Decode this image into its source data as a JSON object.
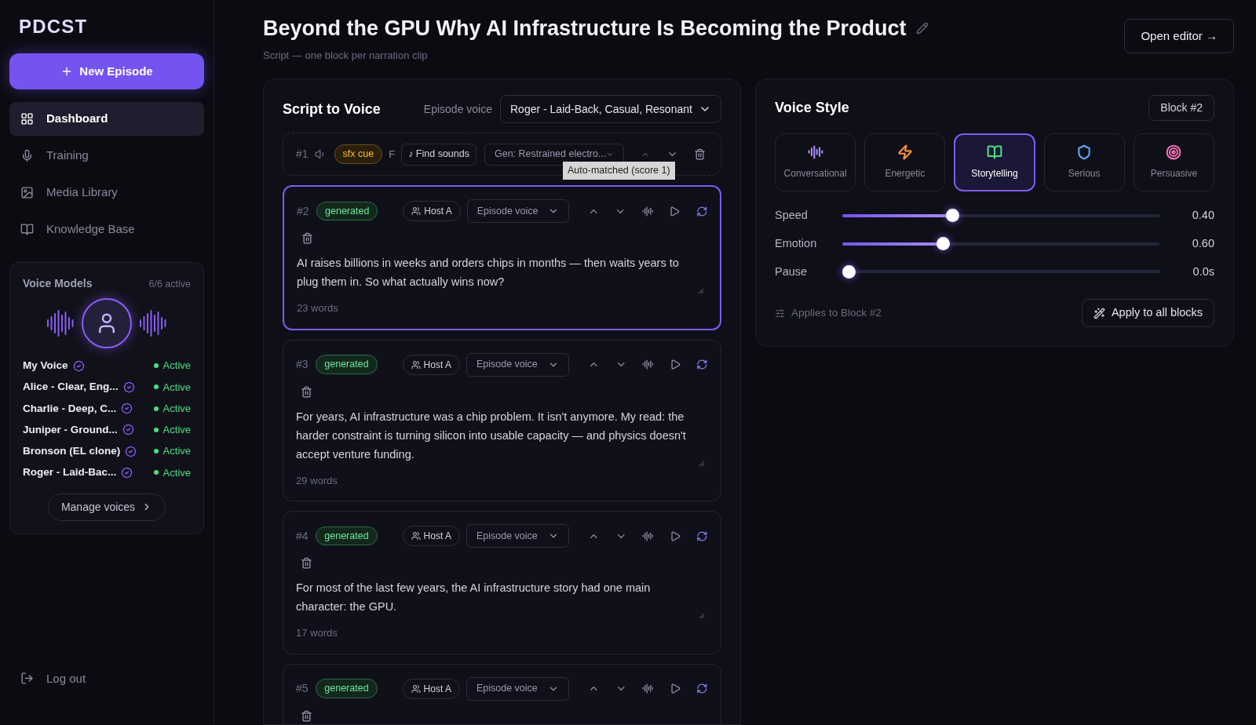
{
  "sidebar": {
    "logo": "PDCST",
    "new_button": "New Episode",
    "nav": [
      {
        "label": "Dashboard",
        "selected": true
      },
      {
        "label": "Training",
        "selected": false
      },
      {
        "label": "Media Library",
        "selected": false
      },
      {
        "label": "Knowledge Base",
        "selected": false
      }
    ],
    "voice_models": {
      "title": "Voice Models",
      "count": "6/6 active",
      "items": [
        {
          "name": "My Voice",
          "status": "Active",
          "color": "#4ade80"
        },
        {
          "name": "Alice - Clear, Eng...",
          "status": "Active",
          "color": "#4ade80"
        },
        {
          "name": "Charlie - Deep, C...",
          "status": "Active",
          "color": "#4ade80"
        },
        {
          "name": "Juniper - Ground...",
          "status": "Active",
          "color": "#4ade80"
        },
        {
          "name": "Bronson (EL clone)",
          "status": "Active",
          "color": "#4ade80"
        },
        {
          "name": "Roger - Laid-Bac...",
          "status": "Active",
          "color": "#4ade80"
        }
      ],
      "manage": "Manage voices"
    },
    "logout": "Log out"
  },
  "header": {
    "title": "Beyond the GPU Why AI Infrastructure Is Becoming the Product",
    "subtitle": "Script — one block per narration clip",
    "open_editor": "Open editor →"
  },
  "script": {
    "title": "Script to Voice",
    "voice_label": "Episode voice",
    "voice_value": "Roger - Laid-Back, Casual, Resonant",
    "sfx": {
      "number": "#1",
      "tag": "sfx cue",
      "cut_text": "F",
      "find": "♪ Find sounds",
      "select": "Gen: Restrained electro...",
      "tooltip": "Auto-matched (score 1)"
    },
    "blocks": [
      {
        "number": "#2",
        "status": "generated",
        "host": "Host A",
        "voice": "Episode voice",
        "selected": true,
        "text": "AI raises billions in weeks and orders chips in months — then waits years to plug them in. So what actually wins now?",
        "words": "23 words"
      },
      {
        "number": "#3",
        "status": "generated",
        "host": "Host A",
        "voice": "Episode voice",
        "selected": false,
        "text": "For years, AI infrastructure was a chip problem. It isn't anymore. My read: the harder constraint is turning silicon into usable capacity — and physics doesn't accept venture funding.",
        "words": "29 words"
      },
      {
        "number": "#4",
        "status": "generated",
        "host": "Host A",
        "voice": "Episode voice",
        "selected": false,
        "text": "For most of the last few years, the AI infrastructure story had one main character: the GPU.",
        "words": "17 words"
      },
      {
        "number": "#5",
        "status": "generated",
        "host": "Host A",
        "voice": "Episode voice",
        "selected": false
      }
    ]
  },
  "style": {
    "title": "Voice Style",
    "block": "Block #2",
    "presets": [
      {
        "label": "Conversational",
        "color": "#a78bfa",
        "selected": false
      },
      {
        "label": "Energetic",
        "color": "#fb923c",
        "selected": false
      },
      {
        "label": "Storytelling",
        "color": "#4ade80",
        "selected": true
      },
      {
        "label": "Serious",
        "color": "#60a5fa",
        "selected": false
      },
      {
        "label": "Persuasive",
        "color": "#f472b6",
        "selected": false
      }
    ],
    "sliders": [
      {
        "label": "Speed",
        "level": 0.34,
        "reading": "0.40"
      },
      {
        "label": "Emotion",
        "level": 0.31,
        "reading": "0.60"
      },
      {
        "label": "Pause",
        "level": 0.0,
        "reading": "0.0s"
      }
    ],
    "applies": "Applies to Block #2",
    "apply_all": "Apply to all blocks"
  }
}
